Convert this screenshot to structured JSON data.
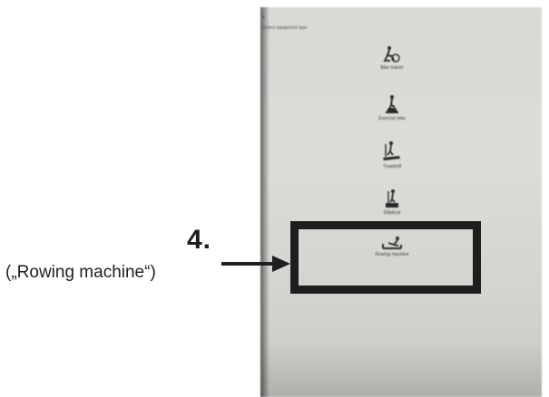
{
  "screen": {
    "back_symbol": "‹",
    "subtitle": "Select equipment type",
    "options": [
      {
        "label": "Bike trainer",
        "icon": "bike-trainer-icon"
      },
      {
        "label": "Exercise bike",
        "icon": "exercise-bike-icon"
      },
      {
        "label": "Treadmill",
        "icon": "treadmill-icon"
      },
      {
        "label": "Elliptical",
        "icon": "elliptical-icon"
      },
      {
        "label": "Rowing machine",
        "icon": "rowing-machine-icon"
      }
    ]
  },
  "annotation": {
    "number": "4.",
    "text": "(„Rowing machine“)",
    "highlighted_option": "Rowing machine",
    "color": "#1e1e1e"
  }
}
